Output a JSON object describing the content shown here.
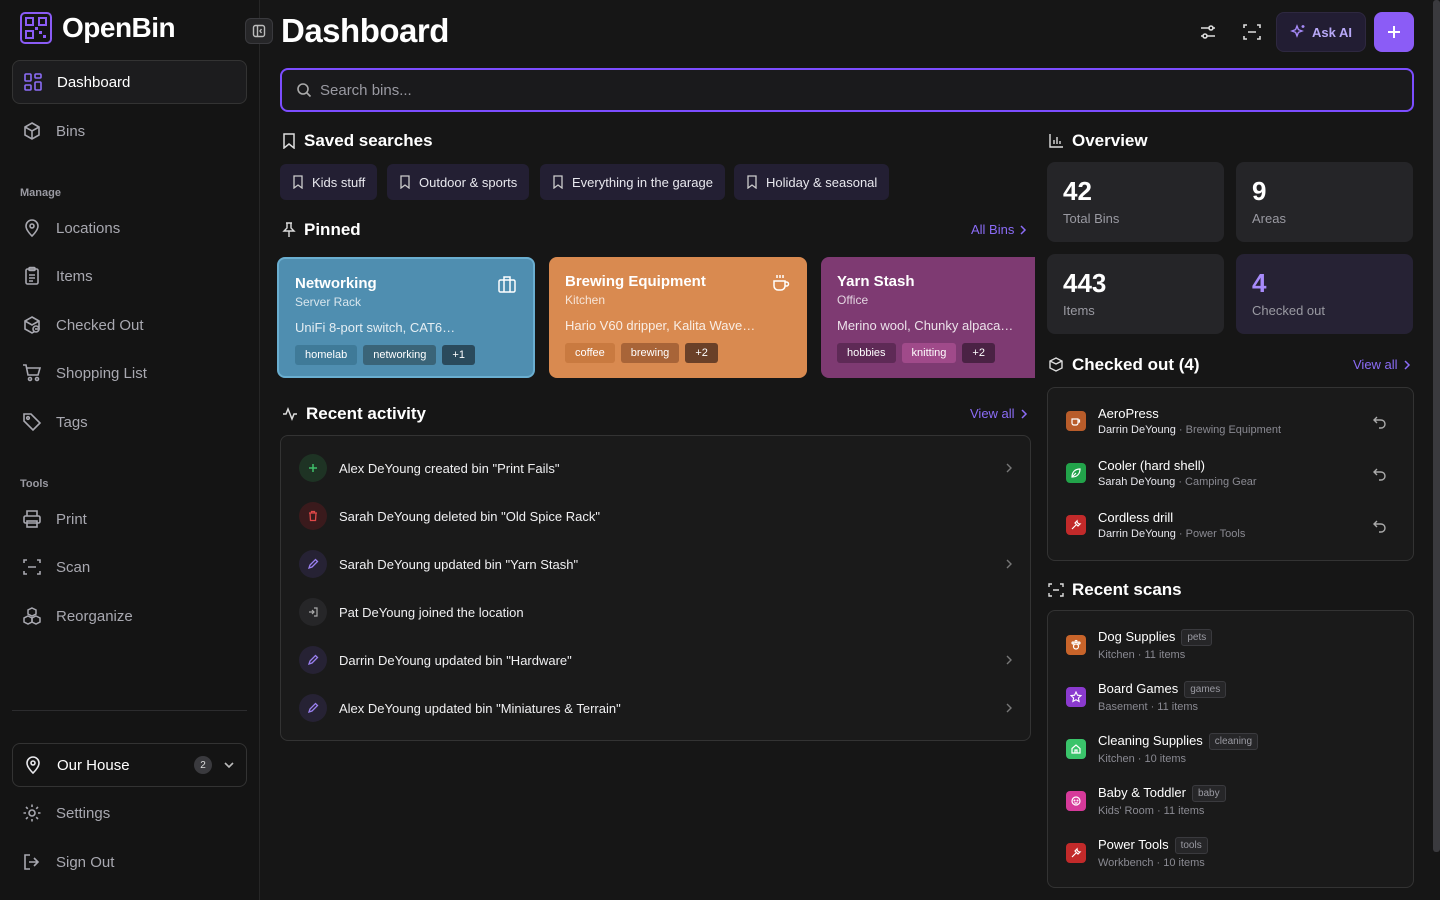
{
  "app": {
    "name": "OpenBin"
  },
  "sidebar": {
    "nav": [
      {
        "label": "Dashboard",
        "icon": "grid-icon"
      },
      {
        "label": "Bins",
        "icon": "box-icon"
      }
    ],
    "manage_label": "Manage",
    "manage": [
      {
        "label": "Locations",
        "icon": "map-pin-icon"
      },
      {
        "label": "Items",
        "icon": "clipboard-icon"
      },
      {
        "label": "Checked Out",
        "icon": "package-out-icon"
      },
      {
        "label": "Shopping List",
        "icon": "cart-icon"
      },
      {
        "label": "Tags",
        "icon": "tag-icon"
      }
    ],
    "tools_label": "Tools",
    "tools": [
      {
        "label": "Print",
        "icon": "printer-icon"
      },
      {
        "label": "Scan",
        "icon": "scan-icon"
      },
      {
        "label": "Reorganize",
        "icon": "boxes-icon"
      }
    ],
    "location": {
      "name": "Our House",
      "count": "2"
    },
    "settings": "Settings",
    "sign_out": "Sign Out"
  },
  "header": {
    "title": "Dashboard",
    "ask_ai": "Ask AI"
  },
  "search": {
    "placeholder": "Search bins..."
  },
  "saved_searches": {
    "title": "Saved searches",
    "items": [
      "Kids stuff",
      "Outdoor & sports",
      "Everything in the garage",
      "Holiday & seasonal"
    ]
  },
  "pinned": {
    "title": "Pinned",
    "link": "All Bins",
    "cards": [
      {
        "name": "Networking",
        "area": "Server Rack",
        "items": "UniFi 8-port switch, CAT6…",
        "tags": [
          "homelab",
          "networking",
          "+1"
        ],
        "color": "#4f8eb0"
      },
      {
        "name": "Brewing Equipment",
        "area": "Kitchen",
        "items": "Hario V60 dripper, Kalita Wave…",
        "tags": [
          "coffee",
          "brewing",
          "+2"
        ],
        "color": "#d98a50"
      },
      {
        "name": "Yarn Stash",
        "area": "Office",
        "items": "Merino wool, Chunky alpaca…",
        "tags": [
          "hobbies",
          "knitting",
          "+2"
        ],
        "color": "#7e3a72"
      }
    ]
  },
  "activity": {
    "title": "Recent activity",
    "link": "View all",
    "items": [
      {
        "text": "Alex DeYoung created bin \"Print Fails\"",
        "type": "create"
      },
      {
        "text": "Sarah DeYoung deleted bin \"Old Spice Rack\"",
        "type": "delete"
      },
      {
        "text": "Sarah DeYoung updated bin \"Yarn Stash\"",
        "type": "update"
      },
      {
        "text": "Pat DeYoung joined the location",
        "type": "join"
      },
      {
        "text": "Darrin DeYoung updated bin \"Hardware\"",
        "type": "update"
      },
      {
        "text": "Alex DeYoung updated bin \"Miniatures & Terrain\"",
        "type": "update"
      }
    ]
  },
  "overview": {
    "title": "Overview",
    "stats": [
      {
        "value": "42",
        "label": "Total Bins"
      },
      {
        "value": "9",
        "label": "Areas"
      },
      {
        "value": "443",
        "label": "Items"
      },
      {
        "value": "4",
        "label": "Checked out"
      }
    ]
  },
  "checked_out": {
    "title": "Checked out (4)",
    "link": "View all",
    "items": [
      {
        "name": "AeroPress",
        "user": "Darrin DeYoung",
        "bin": " · Brewing Equipment",
        "color": "#b85c2a"
      },
      {
        "name": "Cooler (hard shell)",
        "user": "Sarah DeYoung",
        "bin": " · Camping Gear",
        "color": "#22a34a"
      },
      {
        "name": "Cordless drill",
        "user": "Darrin DeYoung",
        "bin": " · Power Tools",
        "color": "#c22a2a"
      }
    ]
  },
  "recent_scans": {
    "title": "Recent scans",
    "items": [
      {
        "name": "Dog Supplies",
        "tag": "pets",
        "sub": "Kitchen · 11 items",
        "color": "#c8642a"
      },
      {
        "name": "Board Games",
        "tag": "games",
        "sub": "Basement · 11 items",
        "color": "#8b3acf"
      },
      {
        "name": "Cleaning Supplies",
        "tag": "cleaning",
        "sub": "Kitchen · 10 items",
        "color": "#3ac46a"
      },
      {
        "name": "Baby & Toddler",
        "tag": "baby",
        "sub": "Kids' Room · 11 items",
        "color": "#d63a9a"
      },
      {
        "name": "Power Tools",
        "tag": "tools",
        "sub": "Workbench · 10 items",
        "color": "#c22a2a"
      }
    ]
  }
}
